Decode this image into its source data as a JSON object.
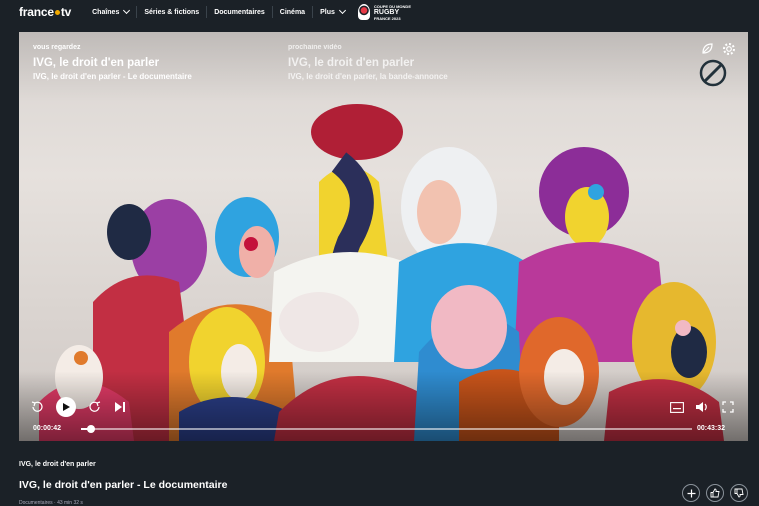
{
  "header": {
    "logo": "france",
    "logo_suffix": "tv",
    "nav": [
      {
        "label": "Chaînes",
        "has_dropdown": true
      },
      {
        "label": "Séries & fictions",
        "has_dropdown": false
      },
      {
        "label": "Documentaires",
        "has_dropdown": false
      },
      {
        "label": "Cinéma",
        "has_dropdown": false
      },
      {
        "label": "Plus",
        "has_dropdown": true
      }
    ],
    "promo": {
      "line1": "COUPE DU MONDE",
      "line2": "RUGBY",
      "line3": "FRANCE 2023"
    }
  },
  "player": {
    "now_label": "vous regardez",
    "now_title": "IVG, le droit d'en parler",
    "now_subtitle": "IVG, le droit d'en parler - Le documentaire",
    "next_label": "prochaine vidéo",
    "next_title": "IVG, le droit d'en parler",
    "next_subtitle": "IVG, le droit d'en parler, la bande-annonce",
    "elapsed": "00:00:42",
    "duration": "00:43:32",
    "progress": 0.016,
    "icons": [
      "eco-icon",
      "gear-icon",
      "replay-10-icon",
      "play-icon",
      "forward-10-icon",
      "skip-next-icon",
      "subtitles-icon",
      "volume-icon",
      "fullscreen-icon"
    ]
  },
  "content": {
    "program": "IVG, le droit d'en parler",
    "episode": "IVG, le droit d'en parler - Le documentaire",
    "meta": "Documentaires · 43 min 32 s"
  },
  "actions": [
    "add-icon",
    "thumbs-up-icon",
    "thumbs-down-icon"
  ]
}
